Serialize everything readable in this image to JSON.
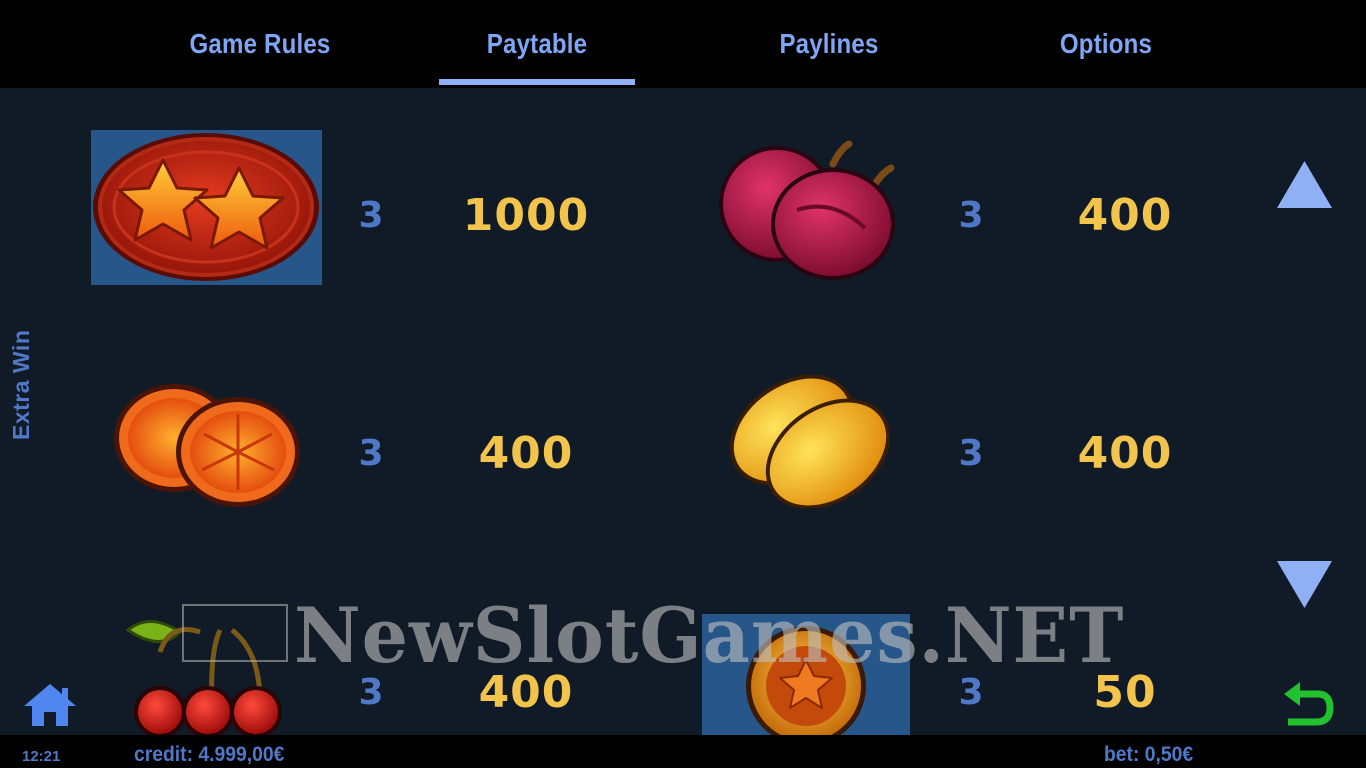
{
  "tabs": [
    {
      "label": "Game Rules",
      "active": false
    },
    {
      "label": "Paytable",
      "active": true
    },
    {
      "label": "Paylines",
      "active": false
    },
    {
      "label": "Options",
      "active": false
    }
  ],
  "side_label": "Extra Win",
  "paytable": [
    {
      "symbol": "stars-scatter-icon",
      "count": "3",
      "payout": "1000"
    },
    {
      "symbol": "plum-icon",
      "count": "3",
      "payout": "400"
    },
    {
      "symbol": "orange-icon",
      "count": "3",
      "payout": "400"
    },
    {
      "symbol": "lemon-icon",
      "count": "3",
      "payout": "400"
    },
    {
      "symbol": "cherry-icon",
      "count": "3",
      "payout": "400"
    },
    {
      "symbol": "star-coin-icon",
      "count": "3",
      "payout": "50"
    }
  ],
  "watermark": "NewSlotGames.NET",
  "status": {
    "time": "12:21",
    "credit": "credit: 4.999,00€",
    "bet": "bet: 0,50€"
  },
  "colors": {
    "tab_text": "#7fa6f5",
    "payout_gold": "#f2c44c",
    "count_blue": "#4f78c7",
    "background": "#111a27",
    "highlight_cell": "#27578a",
    "back_arrow_green": "#22c22f"
  },
  "icons": [
    "home-icon",
    "scroll-up-icon",
    "scroll-down-icon",
    "back-icon"
  ]
}
